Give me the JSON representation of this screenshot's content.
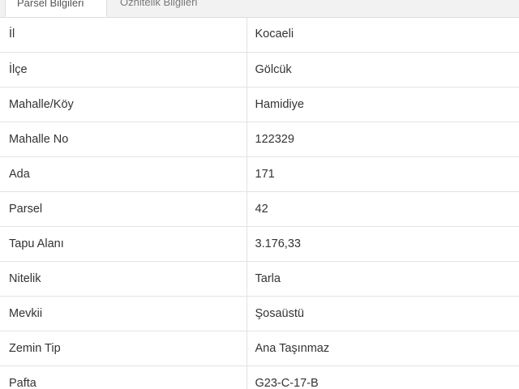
{
  "tabs": [
    {
      "label": "Parsel Bilgileri"
    },
    {
      "label": "Öznitelik Bilgileri"
    }
  ],
  "rows": [
    {
      "label": "İl",
      "value": "Kocaeli"
    },
    {
      "label": "İlçe",
      "value": "Gölcük"
    },
    {
      "label": "Mahalle/Köy",
      "value": "Hamidiye"
    },
    {
      "label": "Mahalle No",
      "value": "122329"
    },
    {
      "label": "Ada",
      "value": "171"
    },
    {
      "label": "Parsel",
      "value": "42"
    },
    {
      "label": "Tapu Alanı",
      "value": "3.176,33"
    },
    {
      "label": "Nitelik",
      "value": "Tarla"
    },
    {
      "label": "Mevkii",
      "value": "Şosaüstü"
    },
    {
      "label": "Zemin Tip",
      "value": "Ana Taşınmaz"
    },
    {
      "label": "Pafta",
      "value": "G23-C-17-B"
    }
  ]
}
